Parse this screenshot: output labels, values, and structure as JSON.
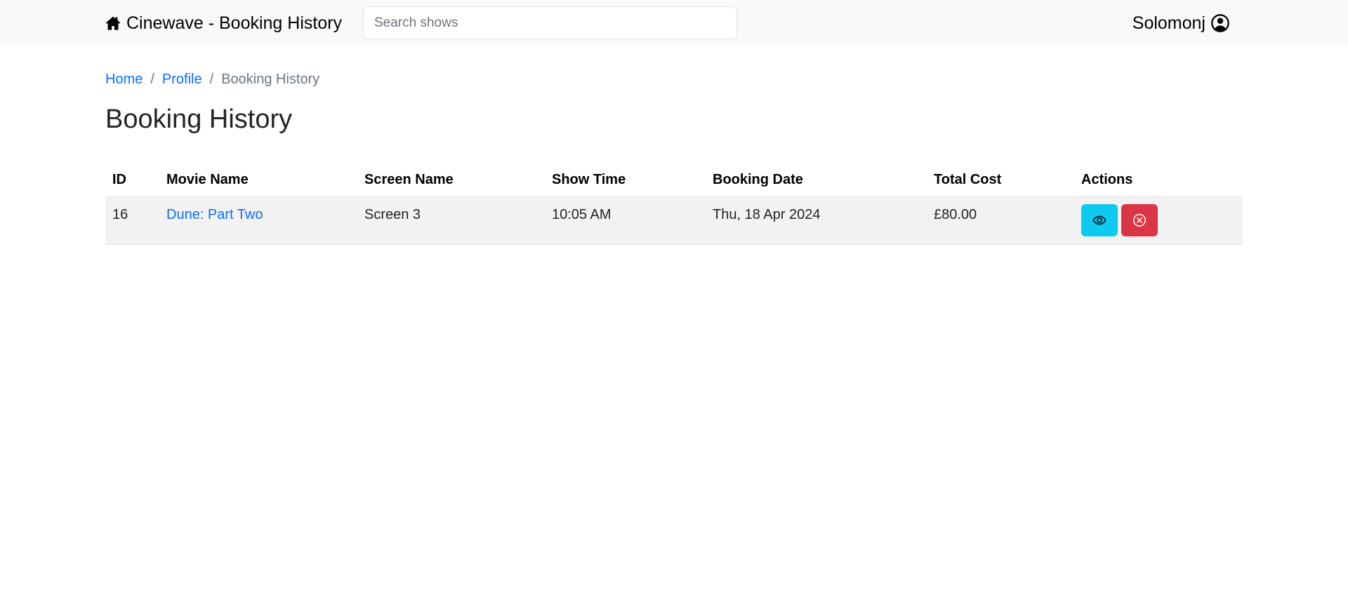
{
  "navbar": {
    "brand_icon": "house-icon",
    "brand": "Cinewave - Booking History",
    "search_placeholder": "Search shows",
    "username": "Solomonj",
    "user_icon": "person-circle-icon"
  },
  "breadcrumb": {
    "items": [
      "Home",
      "Profile"
    ],
    "current": "Booking History",
    "separator": "/"
  },
  "page_title": "Booking History",
  "table": {
    "headers": [
      "ID",
      "Movie Name",
      "Screen Name",
      "Show Time",
      "Booking Date",
      "Total Cost",
      "Actions"
    ],
    "rows": [
      {
        "id": "16",
        "movie": "Dune: Part Two",
        "screen": "Screen 3",
        "show_time": "10:05 AM",
        "booking_date": "Thu, 18 Apr 2024",
        "total_cost": "£80.00",
        "actions": [
          {
            "icon": "eye-icon",
            "color": "#0dcaf0"
          },
          {
            "icon": "x-circle-icon",
            "color": "#dc3545"
          }
        ]
      }
    ]
  }
}
